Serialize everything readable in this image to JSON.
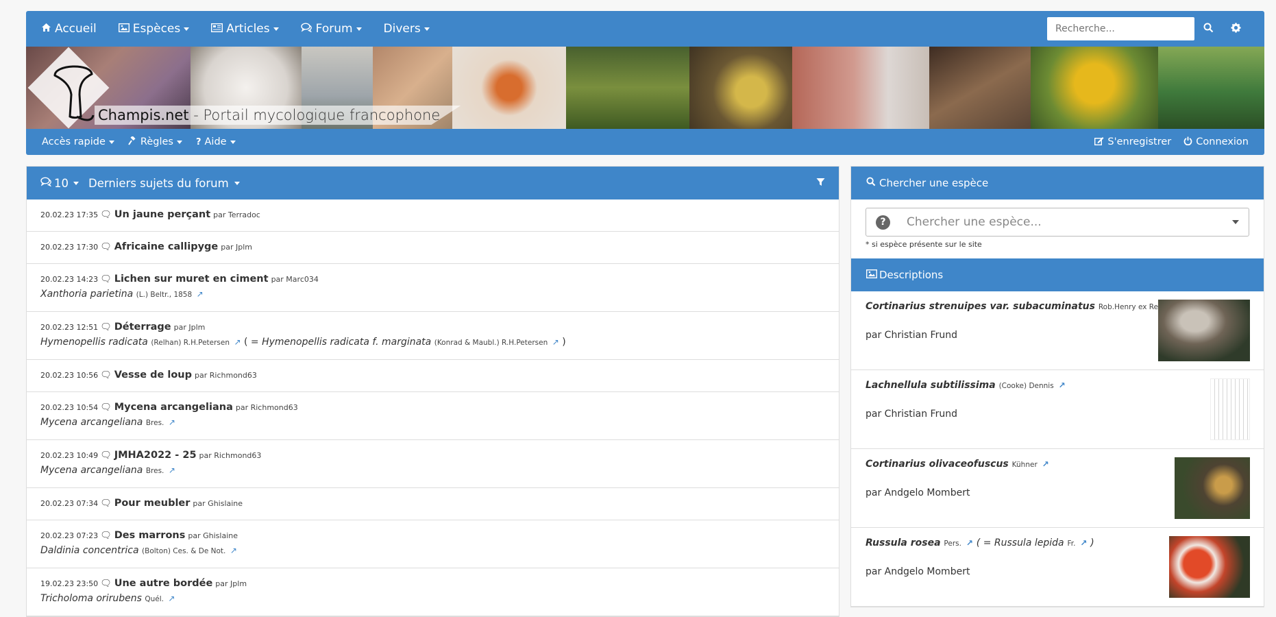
{
  "navbar": {
    "items": [
      {
        "icon": "home-icon",
        "label": "Accueil"
      },
      {
        "icon": "image-icon",
        "label": "Espèces"
      },
      {
        "icon": "newspaper-icon",
        "label": "Articles"
      },
      {
        "icon": "comments-icon",
        "label": "Forum"
      },
      {
        "icon": "",
        "label": "Divers"
      }
    ],
    "search_placeholder": "Recherche..."
  },
  "banner": {
    "title": "Champis.net",
    "subtitle": "- Portail mycologique francophone"
  },
  "subbar": {
    "quick": "Accès rapide",
    "rules": "Règles",
    "help": "Aide",
    "register": "S'enregistrer",
    "login": "Connexion"
  },
  "forum": {
    "count": "10",
    "title": "Derniers sujets du forum",
    "rows": [
      {
        "date": "20.02.23 17:35",
        "title": "Un jaune perçant",
        "by": "par Terradoc"
      },
      {
        "date": "20.02.23 17:30",
        "title": "Africaine callipyge",
        "by": "par Jplm"
      },
      {
        "date": "20.02.23 14:23",
        "title": "Lichen sur muret en ciment",
        "by": "par Marc034",
        "species": "Xanthoria parietina",
        "author": "(L.) Beltr., 1858"
      },
      {
        "date": "20.02.23 12:51",
        "title": "Déterrage",
        "by": "par Jplm",
        "species": "Hymenopellis radicata",
        "author": "(Relhan) R.H.Petersen",
        "syn_open": "( = ",
        "synonym": "Hymenopellis radicata f. marginata",
        "syn_author": "(Konrad & Maubl.) R.H.Petersen",
        "syn_close": ")"
      },
      {
        "date": "20.02.23 10:56",
        "title": "Vesse de loup",
        "by": "par Richmond63"
      },
      {
        "date": "20.02.23 10:54",
        "title": "Mycena arcangeliana",
        "by": "par Richmond63",
        "species": "Mycena arcangeliana",
        "author": "Bres."
      },
      {
        "date": "20.02.23 10:49",
        "title": "JMHA2022 - 25",
        "by": "par Richmond63",
        "species": "Mycena arcangeliana",
        "author": "Bres."
      },
      {
        "date": "20.02.23 07:34",
        "title": "Pour meubler",
        "by": "par Ghislaine"
      },
      {
        "date": "20.02.23 07:23",
        "title": "Des marrons",
        "by": "par Ghislaine",
        "species": "Daldinia concentrica",
        "author": "(Bolton) Ces. & De Not."
      },
      {
        "date": "19.02.23 23:50",
        "title": "Une autre bordée",
        "by": "par Jplm",
        "species": "Tricholoma orirubens",
        "author": "Quél."
      }
    ]
  },
  "side": {
    "search_title": "Chercher une espèce",
    "select_placeholder": "Chercher une espèce...",
    "note": "* si espèce présente sur le site",
    "desc_title": "Descriptions",
    "descriptions": [
      {
        "species": "Cortinarius strenuipes var. subacuminatus",
        "author": "Rob.Henry ex Reumaux",
        "by": "par Christian Frund"
      },
      {
        "species": "Lachnellula subtilissima",
        "author": "(Cooke) Dennis",
        "by": "par Christian Frund"
      },
      {
        "species": "Cortinarius olivaceofuscus",
        "author": "Kühner",
        "by": "par Andgelo Mombert"
      },
      {
        "species": "Russula rosea",
        "author": "Pers.",
        "syn_open": "( = ",
        "synonym": "Russula lepida",
        "syn_author": "Fr.",
        "syn_close": ")",
        "by": "par Andgelo Mombert"
      }
    ]
  },
  "colors": {
    "accent": "#3f86c9",
    "link": "#3f86c9"
  }
}
